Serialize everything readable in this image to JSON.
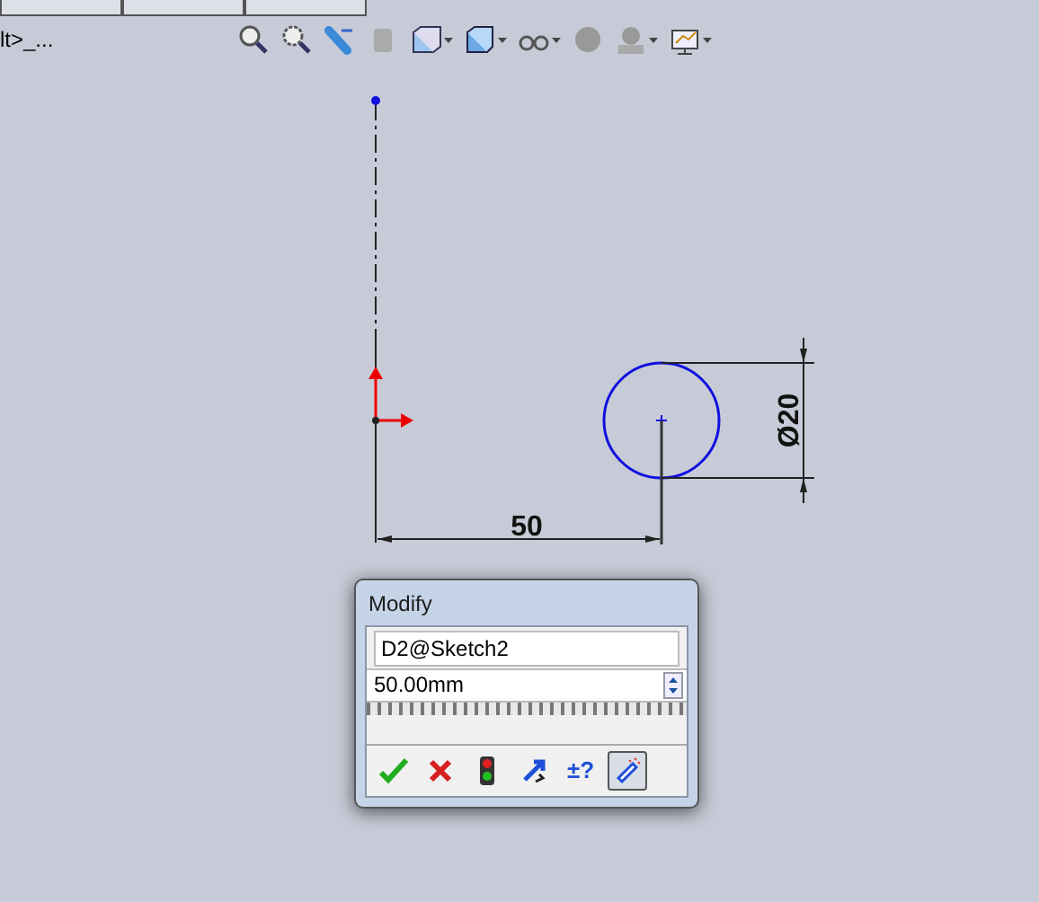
{
  "top_tabs": [
    {
      "selected": false
    },
    {
      "selected": false
    },
    {
      "selected": false
    }
  ],
  "breadcrumb": "lt>_...",
  "sketch": {
    "horizontal_dimension": "50",
    "diameter_dimension": "Ø20"
  },
  "modify_dialog": {
    "title": "Modify",
    "dimension_name": "D2@Sketch2",
    "value": "50.00mm",
    "buttons": [
      {
        "kind": "ok",
        "selected": false
      },
      {
        "kind": "cancel",
        "selected": false
      },
      {
        "kind": "rebuild",
        "selected": false
      },
      {
        "kind": "reverse",
        "selected": false
      },
      {
        "kind": "tolerance",
        "label": "±?",
        "selected": false
      },
      {
        "kind": "mark",
        "selected": true
      }
    ]
  }
}
